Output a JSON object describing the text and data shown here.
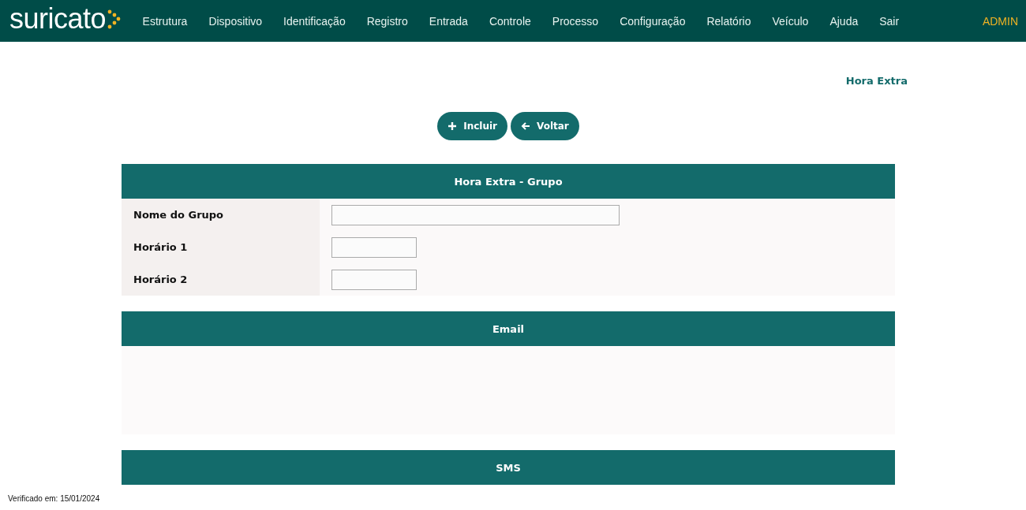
{
  "logo": "suricato",
  "nav": [
    {
      "label": "Estrutura"
    },
    {
      "label": "Dispositivo"
    },
    {
      "label": "Identificação"
    },
    {
      "label": "Registro"
    },
    {
      "label": "Entrada"
    },
    {
      "label": "Controle"
    },
    {
      "label": "Processo"
    },
    {
      "label": "Configuração"
    },
    {
      "label": "Relatório"
    },
    {
      "label": "Veículo"
    },
    {
      "label": "Ajuda"
    },
    {
      "label": "Sair"
    }
  ],
  "user": "ADMIN",
  "page_title": "Hora Extra",
  "buttons": [
    {
      "label": "Incluir",
      "kind": "add"
    },
    {
      "label": "Voltar",
      "kind": "back"
    }
  ],
  "sections": [
    {
      "title": "Hora Extra - Grupo",
      "kind": "form",
      "fields": [
        {
          "label": "Nome do Grupo",
          "kind": "wide"
        },
        {
          "label": "Horário 1",
          "kind": "short"
        },
        {
          "label": "Horário 2",
          "kind": "short"
        }
      ]
    },
    {
      "title": "Email",
      "kind": "empty"
    },
    {
      "title": "SMS",
      "kind": "header"
    }
  ],
  "footer": "Verificado em: 15/01/2024"
}
